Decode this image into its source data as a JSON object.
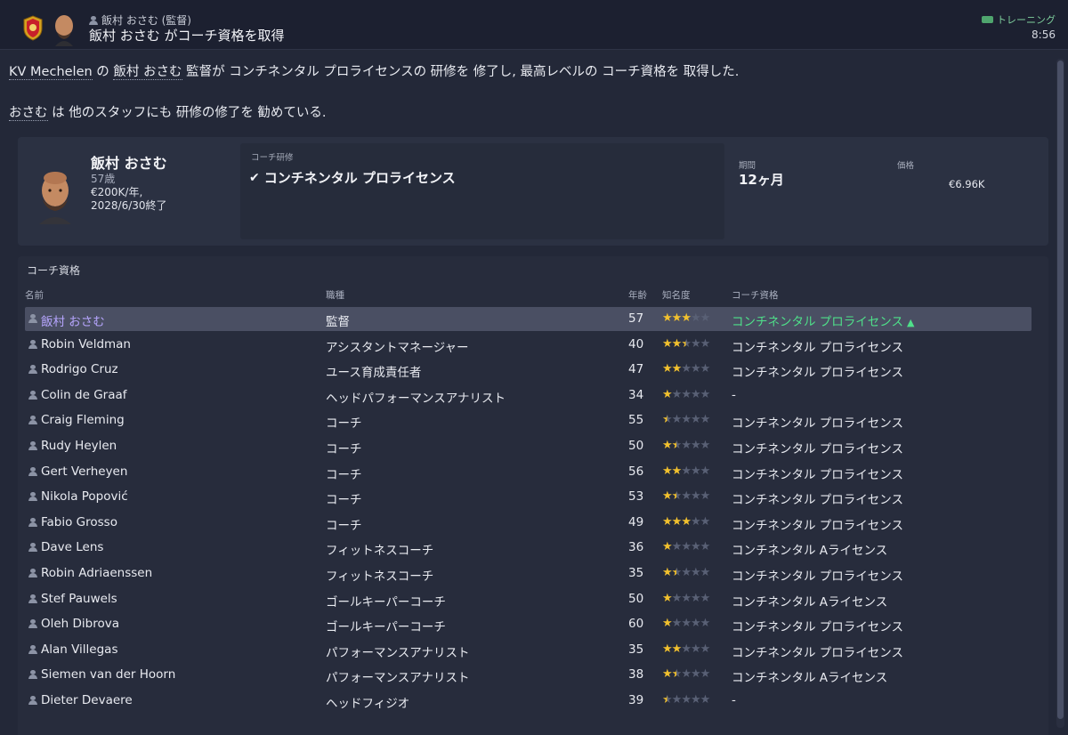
{
  "header": {
    "subtitle": "飯村 おさむ (監督)",
    "title": "飯村 おさむ がコーチ資格を取得",
    "tag": "トレーニング",
    "time": "8:56"
  },
  "news": {
    "line1": {
      "club": "KV Mechelen",
      "p1": " の ",
      "name": "飯村 おさむ",
      "p2": " 監督が コンチネンタル プロライセンスの 研修を 修了し, 最高レベルの コーチ資格を 取得した."
    },
    "line2": {
      "name": "おさむ",
      "p1": " は 他のスタッフにも 研修の修了を 勧めている."
    }
  },
  "card": {
    "name": "飯村 おさむ",
    "age": "57歳",
    "wage": "€200K/年,",
    "contract": "2028/6/30終了",
    "course_label": "コーチ研修",
    "course_name": "コンチネンタル プロライセンス",
    "duration_label": "期間",
    "duration_value": "12ヶ月",
    "price_label": "価格",
    "price_value": "€6.96K"
  },
  "table": {
    "title": "コーチ資格",
    "headers": {
      "name": "名前",
      "role": "職種",
      "age": "年齢",
      "rep": "知名度",
      "qual": "コーチ資格"
    },
    "rows": [
      {
        "name": "飯村 おさむ",
        "role": "監督",
        "age": "57",
        "rep": 3,
        "qual": "コンチネンタル プロライセンス"
      },
      {
        "name": "Robin Veldman",
        "role": "アシスタントマネージャー",
        "age": "40",
        "rep": 2.5,
        "qual": "コンチネンタル プロライセンス"
      },
      {
        "name": "Rodrigo Cruz",
        "role": "ユース育成責任者",
        "age": "47",
        "rep": 2,
        "qual": "コンチネンタル プロライセンス"
      },
      {
        "name": "Colin de Graaf",
        "role": "ヘッドパフォーマンスアナリスト",
        "age": "34",
        "rep": 1,
        "qual": "-"
      },
      {
        "name": "Craig Fleming",
        "role": "コーチ",
        "age": "55",
        "rep": 0.5,
        "qual": "コンチネンタル プロライセンス"
      },
      {
        "name": "Rudy Heylen",
        "role": "コーチ",
        "age": "50",
        "rep": 1.5,
        "qual": "コンチネンタル プロライセンス"
      },
      {
        "name": "Gert Verheyen",
        "role": "コーチ",
        "age": "56",
        "rep": 2,
        "qual": "コンチネンタル プロライセンス"
      },
      {
        "name": "Nikola Popović",
        "role": "コーチ",
        "age": "53",
        "rep": 1.5,
        "qual": "コンチネンタル プロライセンス"
      },
      {
        "name": "Fabio Grosso",
        "role": "コーチ",
        "age": "49",
        "rep": 3,
        "qual": "コンチネンタル プロライセンス"
      },
      {
        "name": "Dave Lens",
        "role": "フィットネスコーチ",
        "age": "36",
        "rep": 1,
        "qual": "コンチネンタル Aライセンス"
      },
      {
        "name": "Robin Adriaenssen",
        "role": "フィットネスコーチ",
        "age": "35",
        "rep": 1.5,
        "qual": "コンチネンタル プロライセンス"
      },
      {
        "name": "Stef Pauwels",
        "role": "ゴールキーパーコーチ",
        "age": "50",
        "rep": 1,
        "qual": "コンチネンタル Aライセンス"
      },
      {
        "name": "Oleh Dibrova",
        "role": "ゴールキーパーコーチ",
        "age": "60",
        "rep": 1,
        "qual": "コンチネンタル プロライセンス"
      },
      {
        "name": "Alan Villegas",
        "role": "パフォーマンスアナリスト",
        "age": "35",
        "rep": 2,
        "qual": "コンチネンタル プロライセンス"
      },
      {
        "name": "Siemen van der Hoorn",
        "role": "パフォーマンスアナリスト",
        "age": "38",
        "rep": 1.5,
        "qual": "コンチネンタル Aライセンス"
      },
      {
        "name": "Dieter Devaere",
        "role": "ヘッドフィジオ",
        "age": "39",
        "rep": 0.5,
        "qual": "-"
      }
    ]
  },
  "colors": {
    "background": "#232838",
    "selected_name": "#b7a6ff",
    "selected_qual": "#4fe08a",
    "star": "#f2c12e",
    "tag": "#7fcf9d"
  }
}
